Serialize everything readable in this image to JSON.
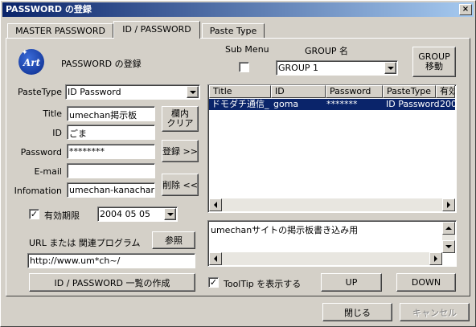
{
  "window": {
    "title": "PASSWORD の登録"
  },
  "tabs": [
    {
      "label": "MASTER PASSWORD"
    },
    {
      "label": "ID / PASSWORD"
    },
    {
      "label": "Paste Type"
    }
  ],
  "header": {
    "logo_text": "Art",
    "heading": "PASSWORD の登録",
    "submenu_label": "Sub Menu",
    "group_label": "GROUP 名",
    "group_value": "GROUP 1",
    "group_move_line1": "GROUP",
    "group_move_line2": "移動"
  },
  "form": {
    "pastetype_label": "PasteType",
    "pastetype_value": "ID Password",
    "title_label": "Title",
    "title_value": "umechan掲示板",
    "id_label": "ID",
    "id_value": "ごま",
    "password_label": "Password",
    "password_value": "********",
    "email_label": "E-mail",
    "email_value": "",
    "info_label": "Infomation",
    "info_value": "umechan-kanachan",
    "clear_line1": "欄内",
    "clear_line2": "クリア",
    "register_label": "登録 >>",
    "delete_label": "削除 <<",
    "expiry_label": "有効期限",
    "expiry_checked": "✓",
    "expiry_value": "2004 05 05",
    "url_label": "URL または 関連プログラム",
    "browse_label": "参照",
    "url_value": "http://www.um*ch~/",
    "make_list_label": "ID / PASSWORD 一覧の作成"
  },
  "list": {
    "columns": [
      "Title",
      "ID",
      "Password",
      "PasteType",
      "有効"
    ],
    "rows": [
      {
        "title": "ドモダチ通信_",
        "id": "goma",
        "password": "*******",
        "pastetype": "ID Password",
        "expiry": "200"
      }
    ]
  },
  "memo": {
    "text": "umechanサイトの掲示板書き込み用"
  },
  "bottom": {
    "tooltip_label": "ToolTip を表示する",
    "tooltip_checked": "✓",
    "up_label": "UP",
    "down_label": "DOWN",
    "close_label": "閉じる",
    "cancel_label": "キャンセル"
  },
  "colors": {
    "title_active": "#0a246a",
    "selection": "#0a246a",
    "face": "#d4d0c8"
  }
}
